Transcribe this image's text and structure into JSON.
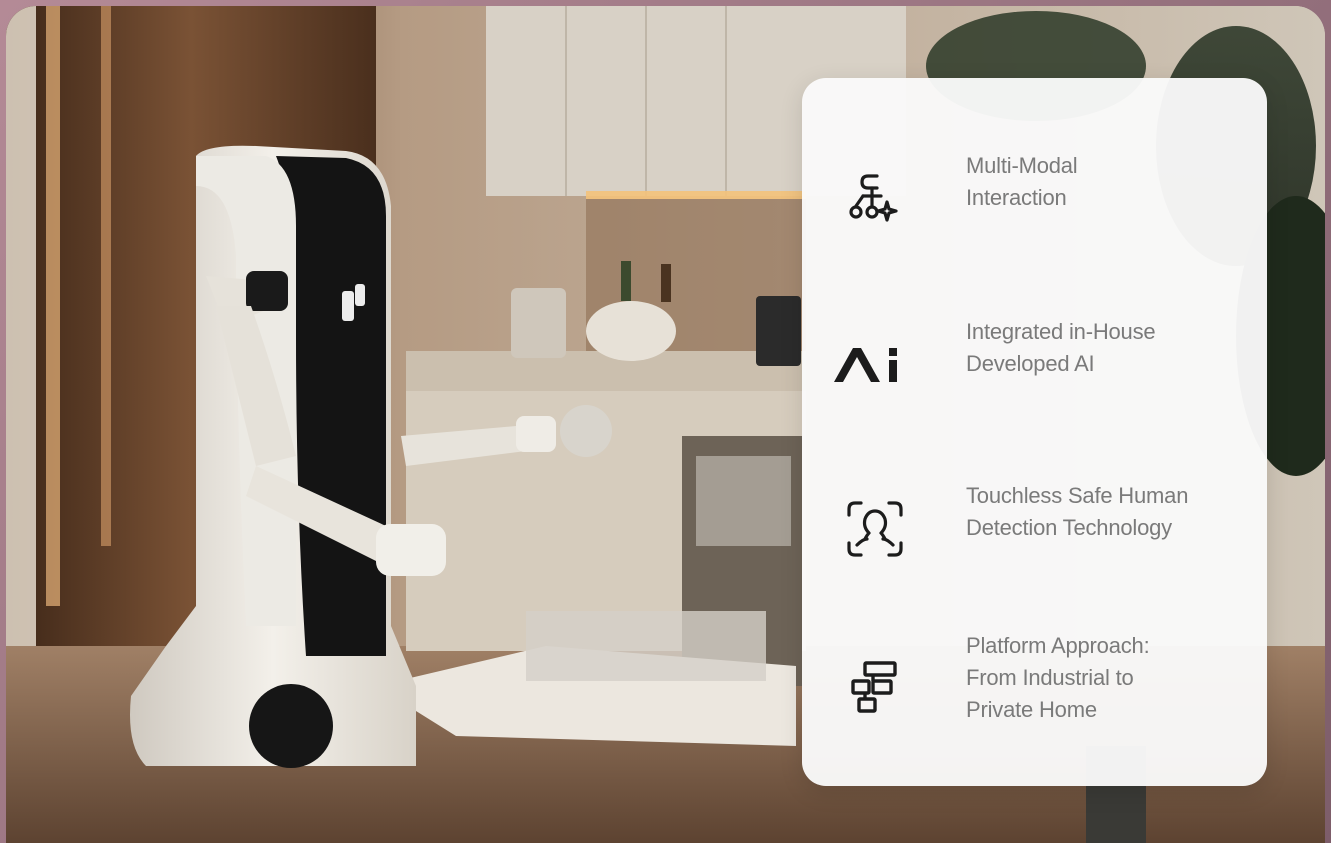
{
  "features": [
    {
      "icon": "multi-modal-icon",
      "label": "Multi-Modal\nInteraction"
    },
    {
      "icon": "ai-logo-icon",
      "label": "Integrated in-House\nDeveloped AI"
    },
    {
      "icon": "face-detection-icon",
      "label": "Touchless Safe Human\nDetection Technology"
    },
    {
      "icon": "platform-icon",
      "label": "Platform Approach:\nFrom Industrial to\nPrivate Home"
    }
  ],
  "colors": {
    "card_background": "#fafafa",
    "label_text": "#7a7a7a",
    "icon": "#1c1c1c",
    "frame": "#b48a96"
  }
}
